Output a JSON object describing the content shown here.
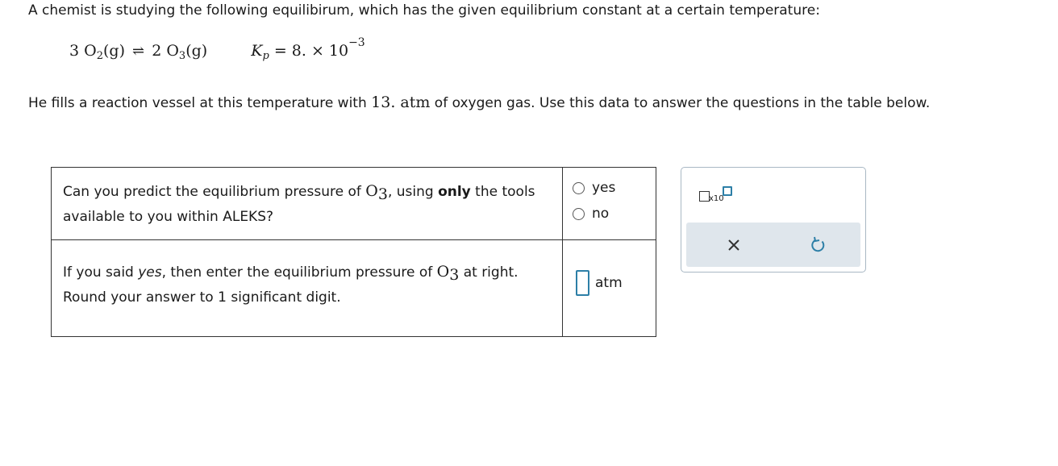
{
  "intro": {
    "text": "A chemist is studying the following equilibirum, which has the given equilibrium constant at a certain temperature:"
  },
  "equation": {
    "reactant_coef": "3",
    "reactant": "O",
    "reactant_sub": "2",
    "reactant_state": "(g)",
    "arrow": "⇌",
    "product_coef": "2",
    "product": "O",
    "product_sub": "3",
    "product_state": "(g)",
    "k_symbol": "K",
    "k_sub": "p",
    "k_value": "= 8. × 10",
    "k_exp": "−3"
  },
  "fill_sentence": {
    "before": "He fills a reaction vessel at this temperature with ",
    "amount": "13. atm",
    "after": " of oxygen gas. Use this data to answer the questions in the table below."
  },
  "questions": {
    "q1": {
      "part1": "Can you predict the equilibrium pressure of ",
      "species": "O",
      "species_sub": "3",
      "part2": ", using ",
      "bold": "only",
      "part3": " the tools available to you within ALEKS?",
      "options": [
        "yes",
        "no"
      ]
    },
    "q2": {
      "part1": "If you said ",
      "italic": "yes",
      "part2": ", then enter the equilibrium pressure of ",
      "species": "O",
      "species_sub": "3",
      "part3": " at right.",
      "line2_pre": "Round your answer to ",
      "line2_num": "1",
      "line2_post": " significant digit.",
      "unit": "atm",
      "input_value": ""
    }
  },
  "toolbox": {
    "sci_label": "x10",
    "icons": [
      "scientific-notation-icon",
      "close-icon",
      "undo-icon"
    ],
    "accent_color": "#2d7fa7"
  }
}
